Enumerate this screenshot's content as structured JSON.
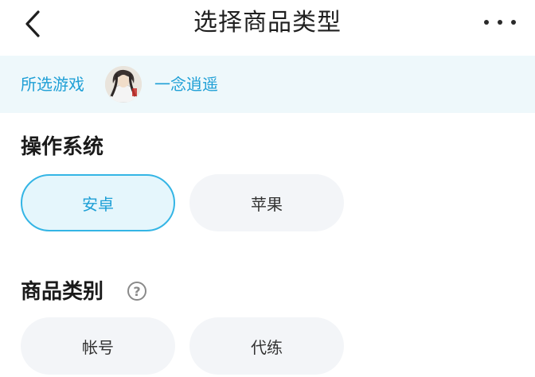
{
  "header": {
    "title": "选择商品类型"
  },
  "game": {
    "label": "所选游戏",
    "name": "一念逍遥"
  },
  "os_section": {
    "title": "操作系统",
    "options": [
      {
        "label": "安卓",
        "selected": true
      },
      {
        "label": "苹果",
        "selected": false
      }
    ]
  },
  "category_section": {
    "title": "商品类别",
    "help_icon": "?",
    "options": [
      {
        "label": "帐号",
        "selected": false
      },
      {
        "label": "代练",
        "selected": false
      }
    ]
  },
  "colors": {
    "accent": "#34b5e5",
    "accent_text": "#1d9fd6",
    "game_bar_bg": "#eef8fb"
  }
}
